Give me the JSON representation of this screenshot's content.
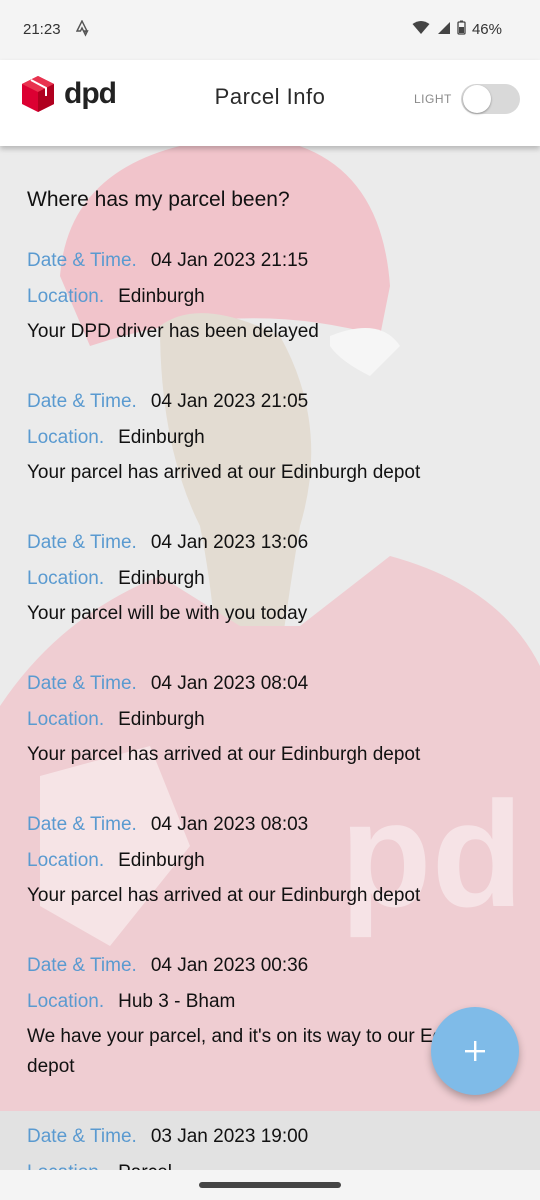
{
  "status_bar": {
    "time": "21:23",
    "battery": "46%",
    "icons": [
      "strava-icon",
      "wifi-icon",
      "signal-icon",
      "battery-icon"
    ]
  },
  "header": {
    "brand": "dpd",
    "title": "Parcel Info",
    "theme_label": "LIGHT",
    "theme_on": false
  },
  "main": {
    "section_title": "Where has my parcel been?",
    "date_label": "Date & Time.",
    "location_label": "Location.",
    "events": [
      {
        "datetime": "04 Jan 2023 21:15",
        "location": "Edinburgh",
        "description": "Your DPD driver has been delayed"
      },
      {
        "datetime": "04 Jan 2023 21:05",
        "location": "Edinburgh",
        "description": "Your parcel has arrived at our Edinburgh depot"
      },
      {
        "datetime": "04 Jan 2023 13:06",
        "location": "Edinburgh",
        "description": "Your parcel will be with you today"
      },
      {
        "datetime": "04 Jan 2023 08:04",
        "location": "Edinburgh",
        "description": "Your parcel has arrived at our Edinburgh depot"
      },
      {
        "datetime": "04 Jan 2023 08:03",
        "location": "Edinburgh",
        "description": "Your parcel has arrived at our Edinburgh depot"
      },
      {
        "datetime": "04 Jan 2023 00:36",
        "location": "Hub 3 - Bham",
        "description": "We have your parcel, and it's on its way to our Edinburgh depot"
      },
      {
        "datetime": "03 Jan 2023 19:00",
        "location": "Parcel",
        "description": ""
      }
    ]
  },
  "fab": {
    "icon": "plus-icon"
  },
  "colors": {
    "accent_label": "#5a9ad0",
    "fab": "#7fbbe8",
    "brand_red": "#dc0032"
  }
}
